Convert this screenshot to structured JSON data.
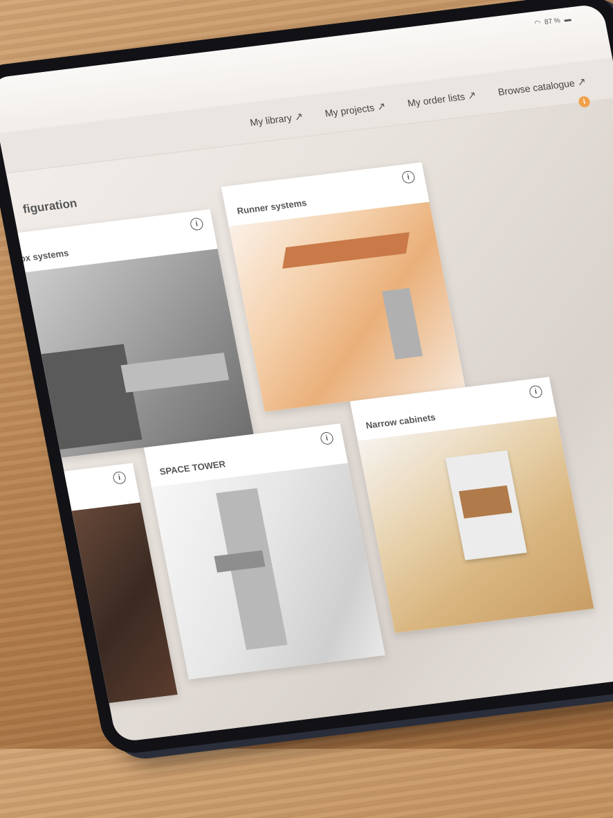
{
  "status": {
    "battery_text": "87 %",
    "wifi_icon": "wifi-icon",
    "battery_icon": "battery-icon"
  },
  "nav": {
    "items": [
      {
        "label": "My library",
        "icon": "arrow-up-right-icon"
      },
      {
        "label": "My projects",
        "icon": "arrow-up-right-icon"
      },
      {
        "label": "My order lists",
        "icon": "arrow-up-right-icon"
      },
      {
        "label": "Browse catalogue",
        "icon": "arrow-up-right-icon"
      }
    ],
    "alert_icon": "info-filled-icon",
    "alert_glyph": "i"
  },
  "section": {
    "title": "figuration"
  },
  "cards": [
    {
      "title": "ox systems",
      "info_glyph": "i"
    },
    {
      "title": "Runner systems",
      "info_glyph": "i"
    },
    {
      "title": "",
      "info_glyph": "i"
    },
    {
      "title": "SPACE TOWER",
      "info_glyph": "i"
    },
    {
      "title": "Narrow cabinets",
      "info_glyph": "i"
    }
  ],
  "colors": {
    "accent": "#f0a14a",
    "bezel": "#121216",
    "screen": "#f1ede9",
    "table_wood": "#c08f5e"
  }
}
